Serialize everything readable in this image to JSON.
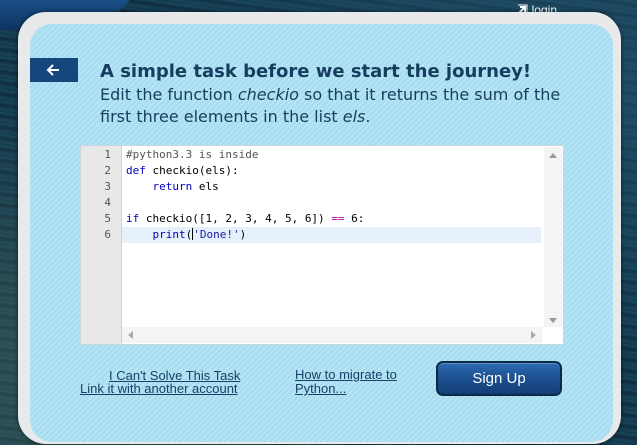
{
  "header": {
    "login_label": "login"
  },
  "intro": {
    "heading": "A simple task before we start the journey!",
    "desc_before": "Edit the function ",
    "desc_func": "checkio",
    "desc_middle": " so that it returns the sum of the first three elements in the list ",
    "desc_var": "els",
    "desc_end": "."
  },
  "editor": {
    "line_numbers": [
      "1",
      "2",
      "3",
      "4",
      "5",
      "6"
    ],
    "lines": {
      "l1": "#python3.3 is inside",
      "l2_kw": "def",
      "l2_rest": " checkio(els):",
      "l3_indent": "    ",
      "l3_kw": "return",
      "l3_rest": " els",
      "l5_kw": "if",
      "l5_a": " checkio([1, 2, 3, 4, 5, 6]) ",
      "l5_op": "==",
      "l5_b": " 6:",
      "l6_indent": "    ",
      "l6_kw": "print",
      "l6_open": "(",
      "l6_str": "'Done!'",
      "l6_close": ")"
    },
    "active_line": 6
  },
  "footer": {
    "cant_solve_label": "I Can't Solve This Task",
    "link_account_label": "Link it with another account",
    "migrate_label": "How to migrate to Python...",
    "signup_label": "Sign Up"
  },
  "icons": {
    "login": "login-arrow-icon",
    "back": "arrow-left-icon"
  },
  "colors": {
    "accent": "#14487d",
    "panel": "#a6dcf0",
    "text": "#173d5e"
  }
}
